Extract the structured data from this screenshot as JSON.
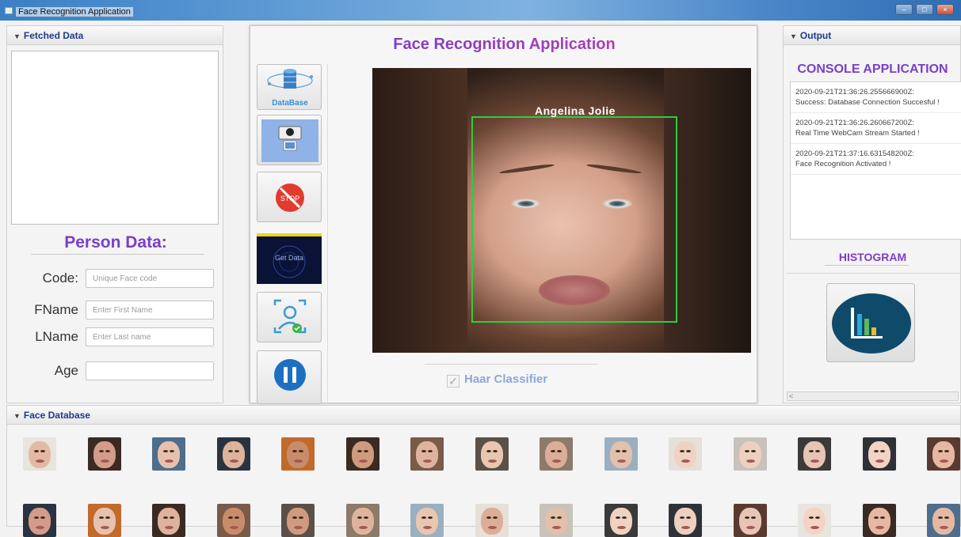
{
  "window": {
    "title": "Face Recognition Application",
    "minimize": "–",
    "maximize": "□",
    "close": "×"
  },
  "left_panel": {
    "header": "Fetched Data",
    "person_title": "Person  Data:",
    "fields": [
      {
        "label": "Code:",
        "placeholder": "Unique Face code"
      },
      {
        "label": "FName",
        "placeholder": "Enter First Name"
      },
      {
        "label": "LName",
        "placeholder": "Enter Last name"
      },
      {
        "label": "Age",
        "placeholder": ""
      }
    ]
  },
  "center": {
    "title": "Face Recognition Application",
    "toolbar": {
      "database_label": "DataBase",
      "getdata_label": "Get Data"
    },
    "detected_name": "Angelina  Jolie",
    "haar_label": "Haar Classifier",
    "haar_checked": "✓"
  },
  "right_panel": {
    "header": "Output",
    "console_title": "CONSOLE APPLICATION",
    "logs": [
      {
        "time": "2020-09-21T21:36:26.255666900Z:",
        "msg": "Success: Database Connection Succesful !"
      },
      {
        "time": "2020-09-21T21:36:26.260667200Z:",
        "msg": " Real Time WebCam Stream Started !"
      },
      {
        "time": "2020-09-21T21:37:16.631548200Z:",
        "msg": "Face Recognition Activated !"
      }
    ],
    "histogram_title": "HISTOGRAM",
    "scroll_arrow": "<"
  },
  "bottom_panel": {
    "header": "Face Database"
  },
  "colors": {
    "accent_purple": "#7a3fc8",
    "header_blue": "#1f3a8a",
    "detect_green": "#2ecc40"
  }
}
